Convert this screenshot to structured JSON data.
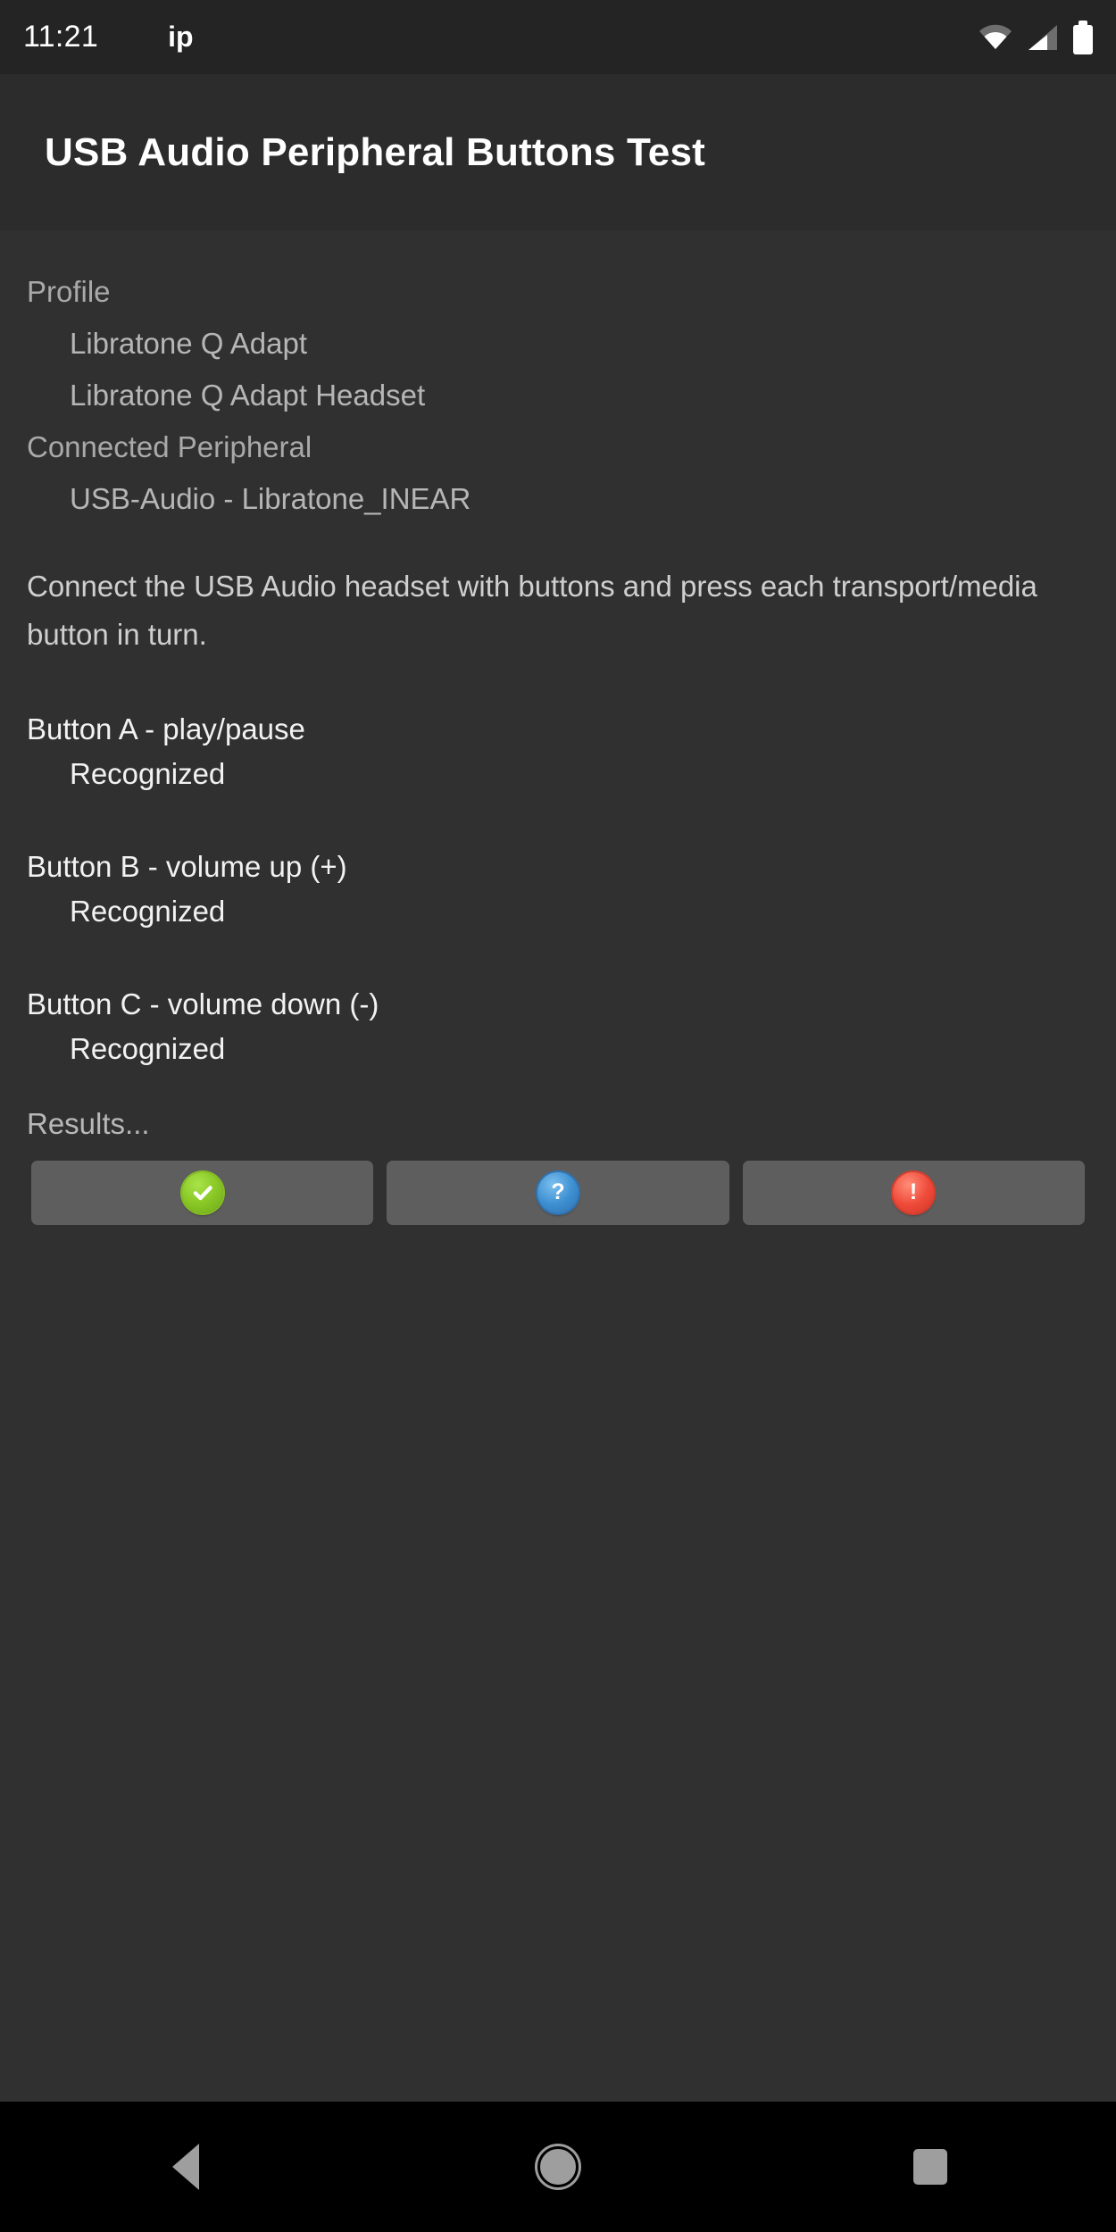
{
  "status_bar": {
    "clock": "11:21",
    "notification_icon": "image-icon",
    "notification_text": "ip",
    "wifi_icon": "wifi-icon",
    "signal_icon": "cellular-signal-icon",
    "battery_icon": "battery-full-icon"
  },
  "header": {
    "title": "USB Audio Peripheral Buttons Test"
  },
  "info": {
    "profile_label": "Profile",
    "profile_values": [
      "Libratone Q Adapt",
      "Libratone Q Adapt Headset"
    ],
    "peripheral_label": "Connected Peripheral",
    "peripheral_values": [
      "USB-Audio - Libratone_INEAR"
    ]
  },
  "instructions": "Connect the USB Audio headset with buttons and press each transport/media button in turn.",
  "button_tests": [
    {
      "title": "Button A - play/pause",
      "status": "Recognized"
    },
    {
      "title": "Button B - volume up (+)",
      "status": "Recognized"
    },
    {
      "title": "Button C - volume down (-)",
      "status": "Recognized"
    }
  ],
  "results": {
    "label": "Results...",
    "buttons": [
      {
        "name": "pass-button",
        "icon": "check-circle-icon",
        "color": "#8ac926"
      },
      {
        "name": "info-button",
        "icon": "question-circle-icon",
        "color": "#3d8fd1"
      },
      {
        "name": "fail-button",
        "icon": "exclamation-circle-icon",
        "color": "#ef4b3a"
      }
    ]
  },
  "nav_bar": {
    "back": "back-icon",
    "home": "home-icon",
    "recents": "recents-icon"
  },
  "colors": {
    "background": "#303030",
    "title_bar": "#2c2c2c",
    "status_bar": "#242424",
    "nav_bar": "#000000",
    "button_face": "#5e5e5e"
  }
}
